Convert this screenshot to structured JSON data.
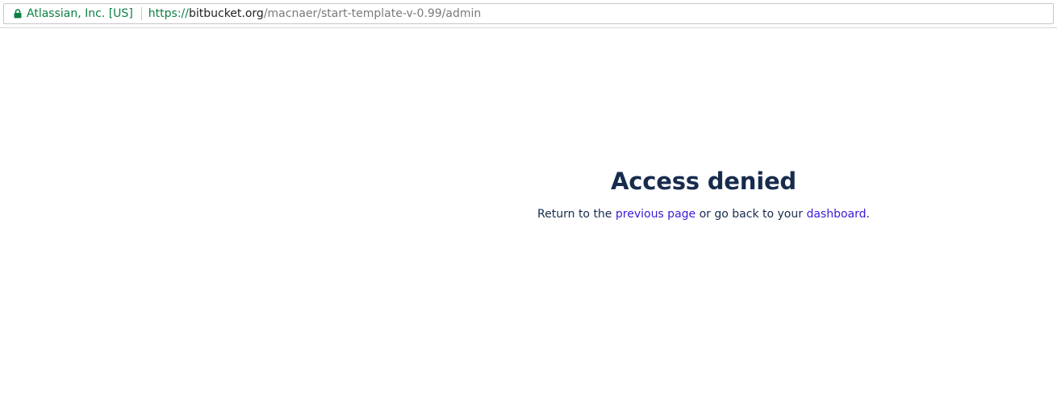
{
  "browser": {
    "cert_label": "Atlassian, Inc. [US]",
    "url_scheme": "https://",
    "url_host": "bitbucket.org",
    "url_path": "/macnaer/start-template-v-0.99/admin",
    "secure_color": "#0b8043"
  },
  "page": {
    "title": "Access denied",
    "message_prefix": "Return to the ",
    "previous_page_link": "previous page",
    "message_middle": " or go back to your ",
    "dashboard_link": "dashboard",
    "message_suffix": ".",
    "text_color": "#172b4d",
    "link_color": "#3e1ad6"
  }
}
